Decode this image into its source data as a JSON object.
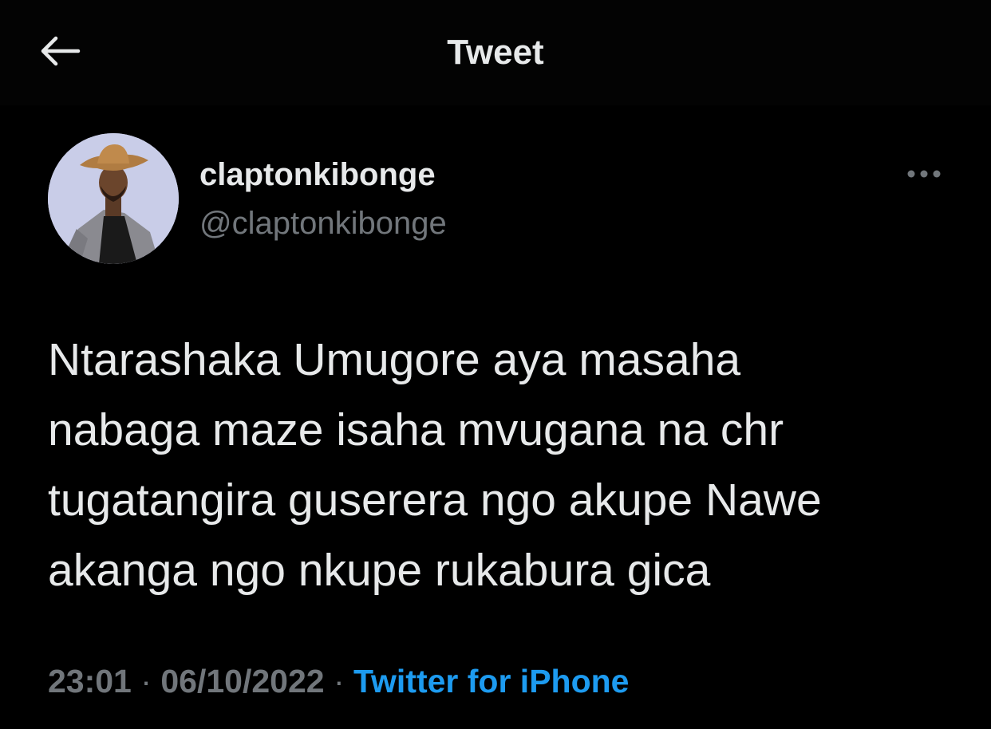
{
  "header": {
    "title": "Tweet",
    "back_icon": "arrow-left-icon"
  },
  "tweet": {
    "author": {
      "display_name": "claptonkibonge",
      "handle": "@claptonkibonge",
      "avatar_icon": "profile-photo"
    },
    "more_icon": "more-horizontal-icon",
    "text": "Ntarashaka Umugore aya masaha\nnabaga maze isaha mvugana na chr\ntugatangira guserera ngo akupe Nawe\nakanga ngo nkupe rukabura gica",
    "time": "23:01",
    "separator": "·",
    "date": "06/10/2022",
    "source": "Twitter for iPhone"
  },
  "colors": {
    "background": "#000000",
    "text_primary": "#e7e9ea",
    "text_secondary": "#71767b",
    "link": "#1d9bf0"
  }
}
